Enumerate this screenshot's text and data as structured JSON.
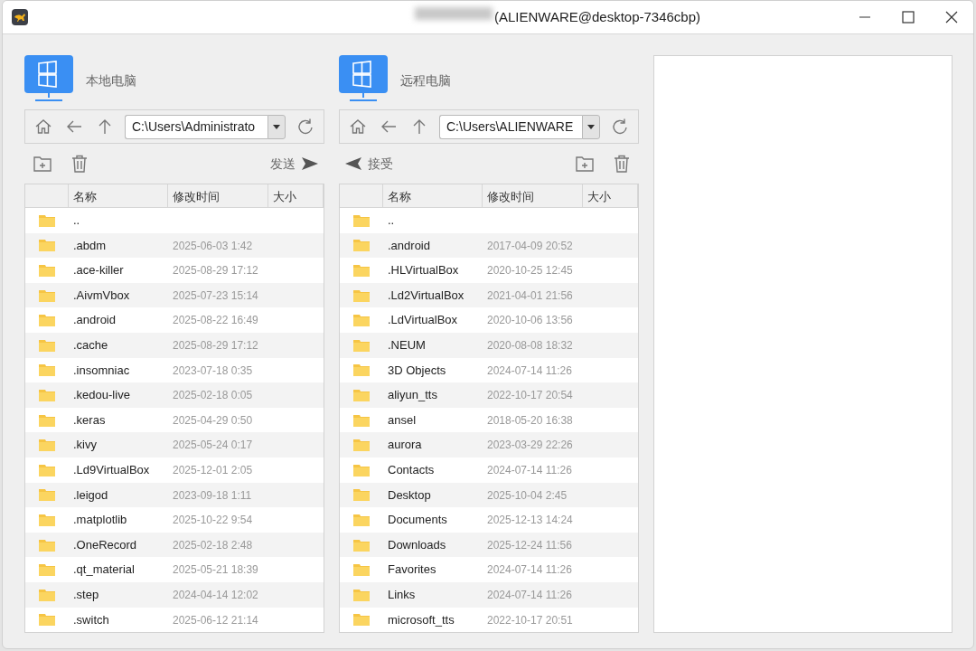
{
  "window": {
    "title": "(ALIENWARE@desktop-7346cbp)"
  },
  "panels": [
    {
      "title": "本地电脑",
      "path": "C:\\Users\\Administrato",
      "action": {
        "kind": "send",
        "label": "发送"
      },
      "columns": [
        "名称",
        "修改时间",
        "大小"
      ],
      "rows": [
        {
          "name": "..",
          "modified": ""
        },
        {
          "name": ".abdm",
          "modified": "2025-06-03 1:42"
        },
        {
          "name": ".ace-killer",
          "modified": "2025-08-29 17:12"
        },
        {
          "name": ".AivmVbox",
          "modified": "2025-07-23 15:14"
        },
        {
          "name": ".android",
          "modified": "2025-08-22 16:49"
        },
        {
          "name": ".cache",
          "modified": "2025-08-29 17:12"
        },
        {
          "name": ".insomniac",
          "modified": "2023-07-18 0:35"
        },
        {
          "name": ".kedou-live",
          "modified": "2025-02-18 0:05"
        },
        {
          "name": ".keras",
          "modified": "2025-04-29 0:50"
        },
        {
          "name": ".kivy",
          "modified": "2025-05-24 0:17"
        },
        {
          "name": ".Ld9VirtualBox",
          "modified": "2025-12-01 2:05"
        },
        {
          "name": ".leigod",
          "modified": "2023-09-18 1:11"
        },
        {
          "name": ".matplotlib",
          "modified": "2025-10-22 9:54"
        },
        {
          "name": ".OneRecord",
          "modified": "2025-02-18 2:48"
        },
        {
          "name": ".qt_material",
          "modified": "2025-05-21 18:39"
        },
        {
          "name": ".step",
          "modified": "2024-04-14 12:02"
        },
        {
          "name": ".switch",
          "modified": "2025-06-12 21:14"
        }
      ]
    },
    {
      "title": "远程电脑",
      "path": "C:\\Users\\ALIENWARE",
      "action": {
        "kind": "receive",
        "label": "接受"
      },
      "columns": [
        "名称",
        "修改时间",
        "大小"
      ],
      "rows": [
        {
          "name": "..",
          "modified": ""
        },
        {
          "name": ".android",
          "modified": "2017-04-09 20:52"
        },
        {
          "name": ".HLVirtualBox",
          "modified": "2020-10-25 12:45"
        },
        {
          "name": ".Ld2VirtualBox",
          "modified": "2021-04-01 21:56"
        },
        {
          "name": ".LdVirtualBox",
          "modified": "2020-10-06 13:56"
        },
        {
          "name": ".NEUM",
          "modified": "2020-08-08 18:32"
        },
        {
          "name": "3D Objects",
          "modified": "2024-07-14 11:26"
        },
        {
          "name": "aliyun_tts",
          "modified": "2022-10-17 20:54"
        },
        {
          "name": "ansel",
          "modified": "2018-05-20 16:38"
        },
        {
          "name": "aurora",
          "modified": "2023-03-29 22:26"
        },
        {
          "name": "Contacts",
          "modified": "2024-07-14 11:26"
        },
        {
          "name": "Desktop",
          "modified": "2025-10-04 2:45"
        },
        {
          "name": "Documents",
          "modified": "2025-12-13 14:24"
        },
        {
          "name": "Downloads",
          "modified": "2025-12-24 11:56"
        },
        {
          "name": "Favorites",
          "modified": "2024-07-14 11:26"
        },
        {
          "name": "Links",
          "modified": "2024-07-14 11:26"
        },
        {
          "name": "microsoft_tts",
          "modified": "2022-10-17 20:51"
        }
      ]
    }
  ]
}
